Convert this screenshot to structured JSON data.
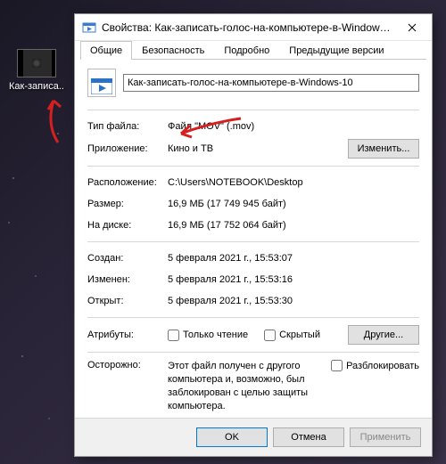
{
  "desktop": {
    "file_label": "Как-записа.."
  },
  "dialog": {
    "title": "Свойства: Как-записать-голос-на-компьютере-в-Windows-...",
    "tabs": {
      "general": "Общие",
      "security": "Безопасность",
      "details": "Подробно",
      "previous": "Предыдущие версии"
    },
    "filename_value": "Как-записать-голос-на-компьютере-в-Windows-10",
    "rows": {
      "type_label": "Тип файла:",
      "type_value": "Файл \"MOV\" (.mov)",
      "app_label": "Приложение:",
      "app_value": "Кино и ТВ",
      "change_button": "Изменить...",
      "location_label": "Расположение:",
      "location_value": "C:\\Users\\NOTEBOOK\\Desktop",
      "size_label": "Размер:",
      "size_value": "16,9 МБ (17 749 945 байт)",
      "ondisk_label": "На диске:",
      "ondisk_value": "16,9 МБ (17 752 064 байт)",
      "created_label": "Создан:",
      "created_value": "5 февраля 2021 г., 15:53:07",
      "modified_label": "Изменен:",
      "modified_value": "5 февраля 2021 г., 15:53:16",
      "accessed_label": "Открыт:",
      "accessed_value": "5 февраля 2021 г., 15:53:30",
      "attributes_label": "Атрибуты:",
      "readonly_label": "Только чтение",
      "hidden_label": "Скрытый",
      "other_button": "Другие...",
      "warning_label": "Осторожно:",
      "warning_text": "Этот файл получен с другого компьютера и, возможно, был заблокирован с целью защиты компьютера.",
      "unblock_label": "Разблокировать"
    },
    "footer": {
      "ok": "OK",
      "cancel": "Отмена",
      "apply": "Применить"
    }
  }
}
